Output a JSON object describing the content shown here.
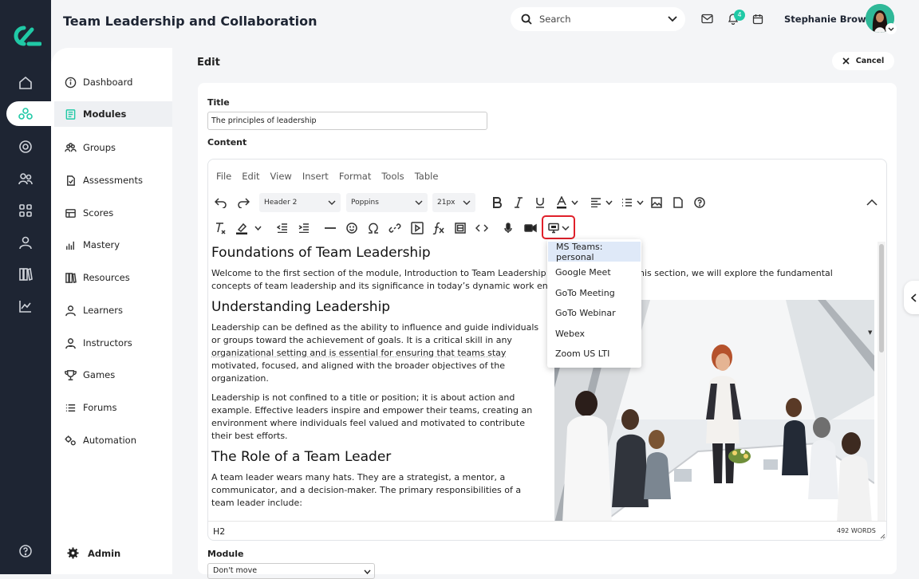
{
  "app": {
    "title": "Team Leadership and Collaboration"
  },
  "search": {
    "placeholder": "Search"
  },
  "notifications": {
    "count": "4"
  },
  "user": {
    "name": "Stephanie Brown"
  },
  "sidebar": {
    "items": [
      {
        "label": "Dashboard",
        "icon": "info-circle-icon"
      },
      {
        "label": "Modules",
        "icon": "modules-icon"
      },
      {
        "label": "Groups",
        "icon": "groups-icon"
      },
      {
        "label": "Assessments",
        "icon": "document-check-icon"
      },
      {
        "label": "Scores",
        "icon": "scores-icon"
      },
      {
        "label": "Mastery",
        "icon": "bar-chart-icon"
      },
      {
        "label": "Resources",
        "icon": "books-icon"
      },
      {
        "label": "Learners",
        "icon": "person-icon"
      },
      {
        "label": "Instructors",
        "icon": "instructor-icon"
      },
      {
        "label": "Games",
        "icon": "trophy-icon"
      },
      {
        "label": "Forums",
        "icon": "list-icon"
      },
      {
        "label": "Automation",
        "icon": "automation-icon"
      }
    ],
    "admin_label": "Admin"
  },
  "page": {
    "heading": "Edit",
    "cancel_label": "Cancel"
  },
  "form": {
    "title_label": "Title",
    "title_value": "The principles of leadership",
    "content_label": "Content",
    "module_label": "Module",
    "module_value": "Don't move"
  },
  "editor": {
    "menu": [
      "File",
      "Edit",
      "View",
      "Insert",
      "Format",
      "Tools",
      "Table"
    ],
    "block_format": "Header 2",
    "font_family": "Poppins",
    "font_size": "21px",
    "status_path": "H2",
    "word_count": "492 WORDS",
    "content": {
      "h1": "Foundations of Team Leadership",
      "p1a": "Welcome to the first section of the module, Introduction to Team Leadership a",
      "p1a_tail": "his section, we will explore the fundamental",
      "p1b": "concepts of team leadership and its significance in today’s dynamic work en",
      "h2": "Understanding Leadership",
      "p2": [
        "Leadership can be defined as the ability to influence and guide individuals",
        "or groups toward the achievement of goals. It is a critical skill in any",
        "organizational setting and is essential for ensuring that teams stay",
        "motivated, focused, and aligned with the broader objectives of the",
        "organization."
      ],
      "p3": [
        "Leadership is not confined to a title or position; it is about action and",
        "example. Effective leaders inspire and empower their teams, creating an",
        "environment where individuals feel valued and motivated to contribute",
        "their best efforts."
      ],
      "h3": "The Role of a Team Leader",
      "p4": [
        "A team leader wears many hats. They are a strategist, a mentor, a",
        "communicator, and a decision-maker. The primary responsibilities of a",
        "team leader include:"
      ]
    },
    "meeting_dropdown": [
      "MS Teams: personal",
      "Google Meet",
      "GoTo Meeting",
      "GoTo Webinar",
      "Webex",
      "Zoom US LTI"
    ]
  },
  "colors": {
    "rail": "#1e2533",
    "accent": "#20c9a6",
    "highlight": "#e0202a"
  }
}
